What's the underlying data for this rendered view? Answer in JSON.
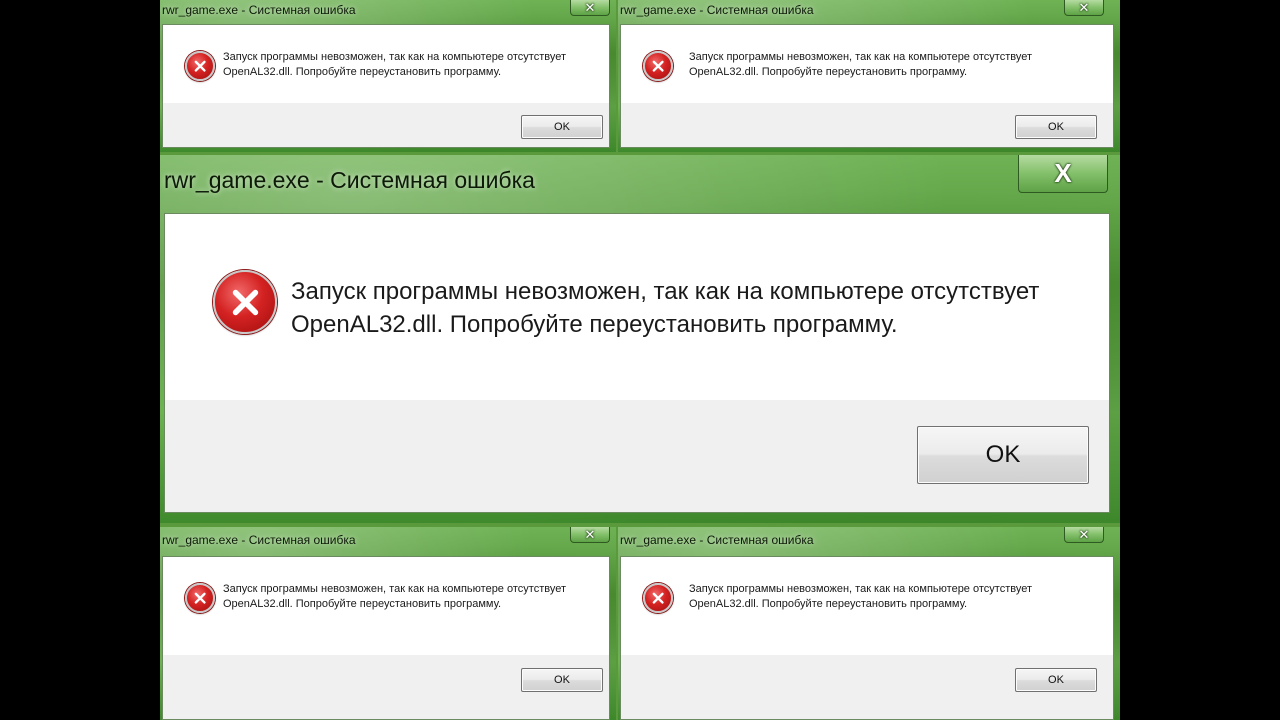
{
  "dialogs": [
    {
      "title": "rwr_game.exe - Системная ошибка",
      "close_label": "✕",
      "icon": "error-icon",
      "message_line1": "Запуск программы невозможен, так как на компьютере отсутствует",
      "message_line2": "OpenAL32.dll. Попробуйте переустановить программу.",
      "ok_label": "OK"
    },
    {
      "title": "rwr_game.exe - Системная ошибка",
      "close_label": "✕",
      "icon": "error-icon",
      "message_line1": "Запуск программы невозможен, так как на компьютере отсутствует",
      "message_line2": "OpenAL32.dll. Попробуйте переустановить программу.",
      "ok_label": "OK"
    },
    {
      "title": "rwr_game.exe - Системная ошибка",
      "close_label": "X",
      "icon": "error-icon",
      "message_line1": "Запуск программы невозможен, так как на компьютере отсутствует",
      "message_line2": "OpenAL32.dll. Попробуйте переустановить программу.",
      "ok_label": "OK"
    },
    {
      "title": "rwr_game.exe - Системная ошибка",
      "close_label": "✕",
      "icon": "error-icon",
      "message_line1": "Запуск программы невозможен, так как на компьютере отсутствует",
      "message_line2": "OpenAL32.dll. Попробуйте переустановить программу.",
      "ok_label": "OK"
    },
    {
      "title": "rwr_game.exe - Системная ошибка",
      "close_label": "✕",
      "icon": "error-icon",
      "message_line1": "Запуск программы невозможен, так как на компьютере отсутствует",
      "message_line2": "OpenAL32.dll. Попробуйте переустановить программу.",
      "ok_label": "OK"
    }
  ],
  "colors": {
    "frame_accent": "#5a9a3c",
    "error_red": "#d42222",
    "client_background": "#f0f0f0",
    "message_background": "#ffffff"
  }
}
